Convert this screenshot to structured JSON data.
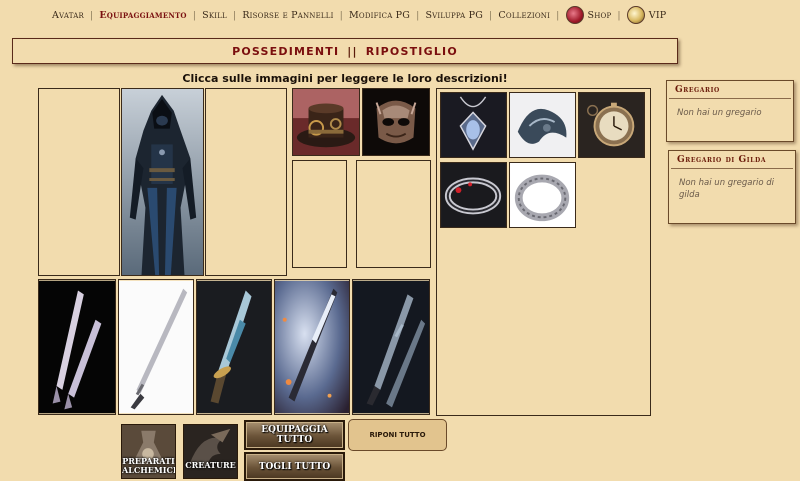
{
  "nav": {
    "items": [
      {
        "label": "Avatar",
        "active": false
      },
      {
        "label": "Equipaggiamento",
        "active": true
      },
      {
        "label": "Skill",
        "active": false
      },
      {
        "label": "Risorse e Pannelli",
        "active": false
      },
      {
        "label": "Modifica PG",
        "active": false
      },
      {
        "label": "Sviluppa PG",
        "active": false
      },
      {
        "label": "Collezioni",
        "active": false
      },
      {
        "label": "Shop",
        "active": false,
        "icon": "shop-icon"
      },
      {
        "label": "VIP",
        "active": false,
        "icon": "vip-icon"
      }
    ]
  },
  "header": {
    "left": "POSSEDIMENTI",
    "divider": "||",
    "right": "RIPOSTIGLIO"
  },
  "instruction": "Clicca sulle immagini per leggere le loro descrizioni!",
  "equipment": {
    "character_image": "hooded-assassin-character-image",
    "accessories": [
      "steampunk-hat-image",
      "carved-mask-image"
    ],
    "weapons": [
      "dual-blades-image",
      "katana-sword-image",
      "ornate-dagger-image",
      "glowing-spear-dagger-image",
      "twin-daggers-image"
    ]
  },
  "storage": {
    "items": [
      "pendant-necklace-image",
      "dragon-brooch-image",
      "pocket-watch-image",
      "ruby-ring-image",
      "silver-ring-image"
    ]
  },
  "buttons": {
    "preparati": "PREPARATI ALCHEMICI",
    "creature": "CREATURE",
    "equipaggia": "EQUIPAGGIA TUTTO",
    "togli": "TOGLI TUTTO",
    "riponi": "RIPONI TUTTO"
  },
  "sidebar": {
    "gregario": {
      "title": "Gregario",
      "text": "Non hai un gregario"
    },
    "gregario_gilda": {
      "title": "Gregario di Gilda",
      "text": "Non hai un gregario di gilda"
    }
  },
  "colors": {
    "background": "#f2dcae",
    "accent": "#7a0e0e",
    "border": "#3a2a1a"
  }
}
